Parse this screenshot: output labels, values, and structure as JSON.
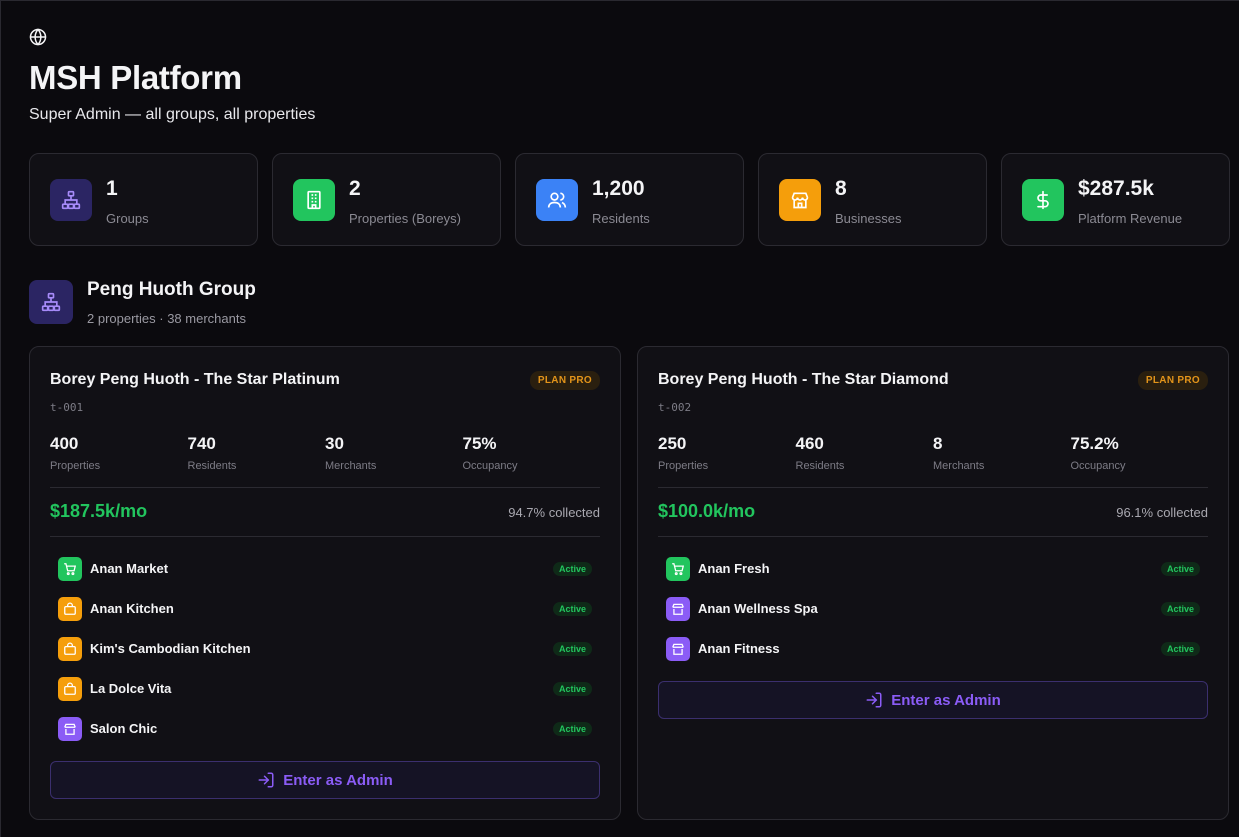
{
  "header": {
    "icon": "globe-icon",
    "title": "MSH Platform",
    "subtitle": "Super Admin — all groups, all properties"
  },
  "stats": [
    {
      "icon": "network-icon",
      "value": "1",
      "label": "Groups",
      "color": "#2b2563"
    },
    {
      "icon": "building-icon",
      "value": "2",
      "label": "Properties (Boreys)",
      "color": "#22c55e"
    },
    {
      "icon": "users-icon",
      "value": "1,200",
      "label": "Residents",
      "color": "#3b82f6"
    },
    {
      "icon": "store-icon",
      "value": "8",
      "label": "Businesses",
      "color": "#f59e0b"
    },
    {
      "icon": "dollar-icon",
      "value": "$287.5k",
      "label": "Platform Revenue",
      "color": "#22c55e"
    }
  ],
  "group": {
    "name": "Peng Huoth Group",
    "meta": "2 properties · 38 merchants",
    "properties": [
      {
        "title": "Borey Peng Huoth - The Star Platinum",
        "plan": "PLAN PRO",
        "id": "t-001",
        "metrics": [
          {
            "value": "400",
            "label": "Properties"
          },
          {
            "value": "740",
            "label": "Residents"
          },
          {
            "value": "30",
            "label": "Merchants"
          },
          {
            "value": "75%",
            "label": "Occupancy"
          }
        ],
        "revenue": "$187.5k/mo",
        "collected": "94.7% collected",
        "merchants": [
          {
            "name": "Anan Market",
            "status": "Active",
            "icon": "cart-icon",
            "color": "#22c55e"
          },
          {
            "name": "Anan Kitchen",
            "status": "Active",
            "icon": "bag-icon",
            "color": "#f59e0b"
          },
          {
            "name": "Kim's Cambodian Kitchen",
            "status": "Active",
            "icon": "bag-icon",
            "color": "#f59e0b"
          },
          {
            "name": "La Dolce Vita",
            "status": "Active",
            "icon": "bag-icon",
            "color": "#f59e0b"
          },
          {
            "name": "Salon Chic",
            "status": "Active",
            "icon": "store-icon",
            "color": "#8b5cf6"
          }
        ],
        "enter_label": "Enter as Admin"
      },
      {
        "title": "Borey Peng Huoth - The Star Diamond",
        "plan": "PLAN PRO",
        "id": "t-002",
        "metrics": [
          {
            "value": "250",
            "label": "Properties"
          },
          {
            "value": "460",
            "label": "Residents"
          },
          {
            "value": "8",
            "label": "Merchants"
          },
          {
            "value": "75.2%",
            "label": "Occupancy"
          }
        ],
        "revenue": "$100.0k/mo",
        "collected": "96.1% collected",
        "merchants": [
          {
            "name": "Anan Fresh",
            "status": "Active",
            "icon": "cart-icon",
            "color": "#22c55e"
          },
          {
            "name": "Anan Wellness Spa",
            "status": "Active",
            "icon": "store-icon",
            "color": "#8b5cf6"
          },
          {
            "name": "Anan Fitness",
            "status": "Active",
            "icon": "store-icon",
            "color": "#8b5cf6"
          }
        ],
        "enter_label": "Enter as Admin"
      }
    ]
  }
}
